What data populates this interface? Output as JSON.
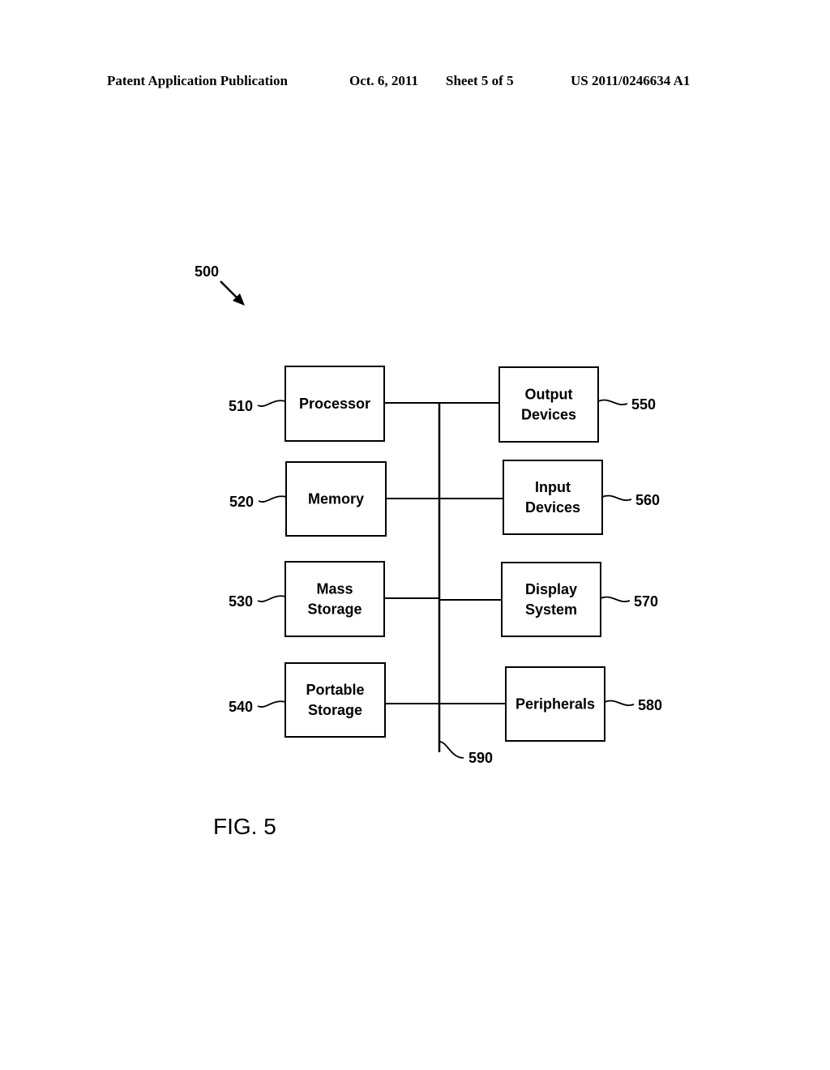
{
  "header": {
    "publication": "Patent Application Publication",
    "date": "Oct. 6, 2011",
    "sheet": "Sheet 5 of 5",
    "number": "US 2011/0246634 A1"
  },
  "figure": {
    "ref": "500",
    "caption": "FIG. 5",
    "bus": {
      "ref": "590"
    },
    "left_blocks": [
      {
        "ref": "510",
        "lines": [
          "Processor"
        ]
      },
      {
        "ref": "520",
        "lines": [
          "Memory"
        ]
      },
      {
        "ref": "530",
        "lines": [
          "Mass",
          "Storage"
        ]
      },
      {
        "ref": "540",
        "lines": [
          "Portable",
          "Storage"
        ]
      }
    ],
    "right_blocks": [
      {
        "ref": "550",
        "lines": [
          "Output",
          "Devices"
        ]
      },
      {
        "ref": "560",
        "lines": [
          "Input",
          "Devices"
        ]
      },
      {
        "ref": "570",
        "lines": [
          "Display",
          "System"
        ]
      },
      {
        "ref": "580",
        "lines": [
          "Peripherals"
        ]
      }
    ]
  }
}
